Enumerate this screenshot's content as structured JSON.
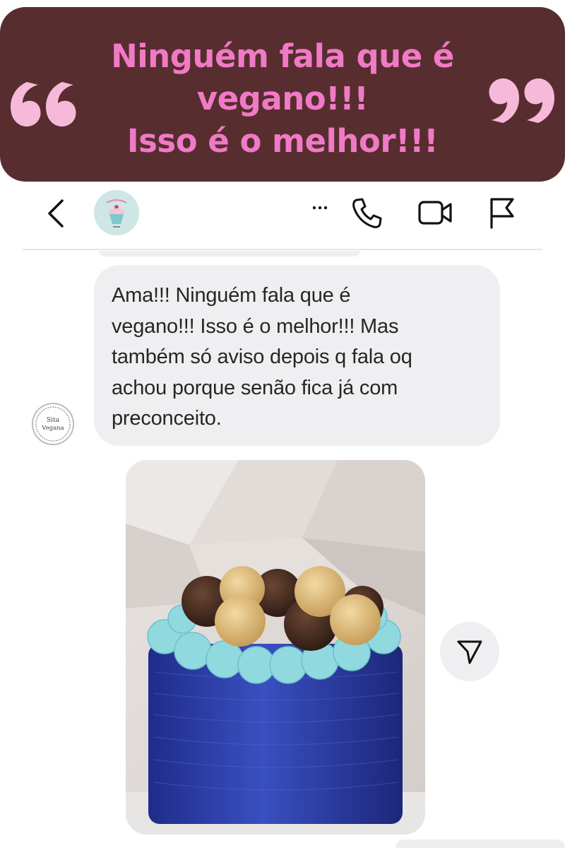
{
  "banner": {
    "line1": "Ninguém fala que é",
    "line2": "vegano!!!",
    "line3": "Isso é o melhor!!!",
    "text_color": "#f07ac6",
    "background": "#582d2f",
    "quote_color": "#f7b9da"
  },
  "header": {
    "back_icon": "chevron-left-icon",
    "more_icon": "ellipsis-icon",
    "call_icon": "phone-icon",
    "video_icon": "video-camera-icon",
    "report_icon": "flag-icon"
  },
  "message": {
    "lines": [
      "Ama!!! Ninguém fala que é",
      "vegano!!! Isso é o melhor!!! Mas",
      "também só aviso depois q fala oq",
      "achou porque senão fica já com",
      "preconceito."
    ],
    "sender_avatar": {
      "line1": "Sita",
      "line2": "Vegana"
    }
  },
  "photo": {
    "subject": "blue cake with mint frosting and brigadeiros",
    "cake_color": "#2f3ea6",
    "frosting_color": "#8fd9df"
  },
  "share_icon": "send-icon"
}
